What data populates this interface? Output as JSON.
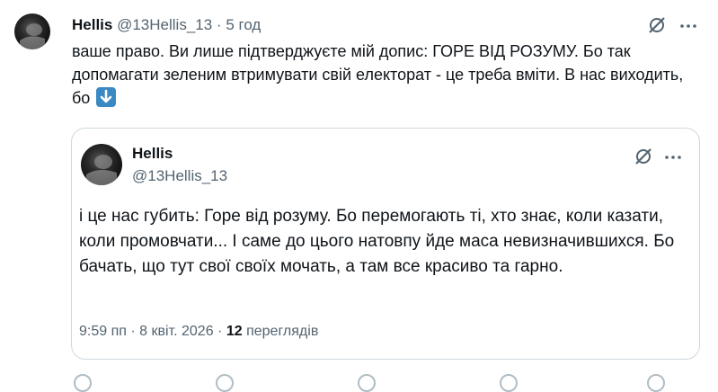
{
  "post": {
    "author_name": "Hellis",
    "handle": "@13Hellis_13",
    "separator": "·",
    "time": "5 год",
    "text": "ваше право. Ви лише підтверджуєте мій допис: ГОРЕ ВІД РОЗУМУ. Бо так допомагати зеленим втримувати свій електорат - це треба вміти. В нас виходить, бо",
    "emoji": "down-arrow-emoji"
  },
  "quote": {
    "author_name": "Hellis",
    "handle": "@13Hellis_13",
    "text": "і це нас губить: Горе від розуму. Бо перемогають ті, хто знає, коли казати, коли промовчати... І саме до цього натовпу йде маса невизначившихся. Бо бачать, що тут свої своїх мочать, а там все красиво та гарно.",
    "time": "9:59 пп",
    "date": "8 квіт. 2026",
    "views_count": "12",
    "views_label": "переглядів",
    "separator": "·"
  },
  "icons": {
    "grok": "grok-slash-icon",
    "more": "more-dots-icon"
  },
  "colors": {
    "text": "#0f1419",
    "muted": "#536471",
    "border": "#cfd9de",
    "emoji_bg": "#3b88c3"
  }
}
